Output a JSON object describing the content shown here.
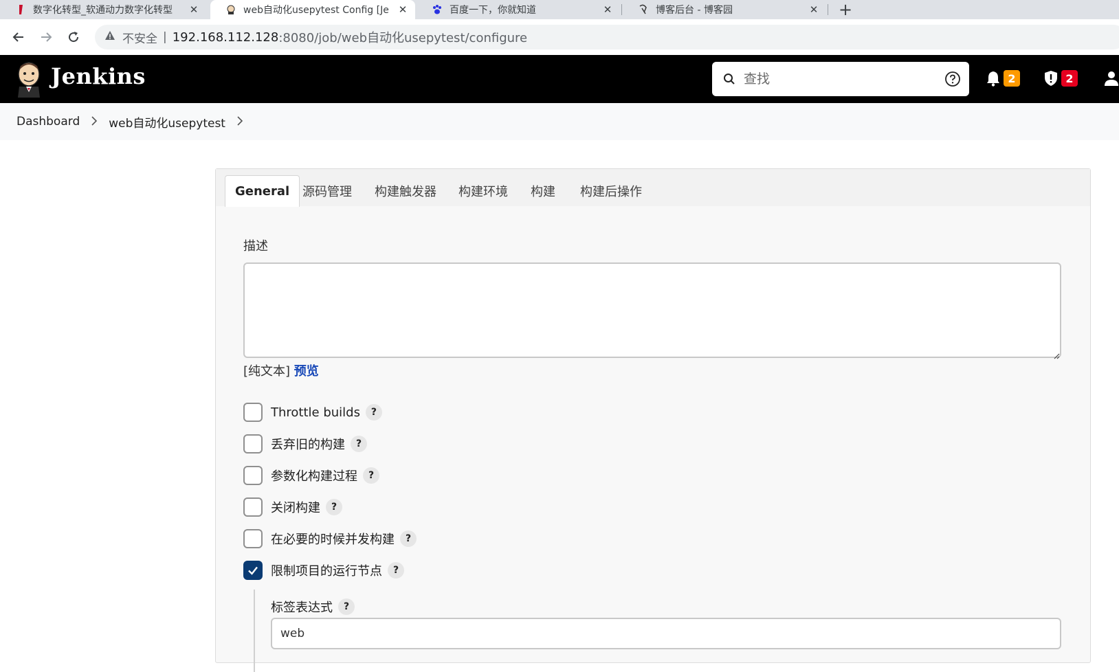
{
  "browser": {
    "tabs": [
      {
        "title": "数字化转型_软通动力数字化转型",
        "favicon": "red-bookmark-icon"
      },
      {
        "title": "web自动化usepytest Config [Je",
        "favicon": "jenkins-butler-icon"
      },
      {
        "title": "百度一下，你就知道",
        "favicon": "baidu-paw-icon"
      },
      {
        "title": "博客后台 - 博客园",
        "favicon": "cnblogs-icon"
      }
    ],
    "address": {
      "insecure_label": "不安全",
      "separator": "|",
      "host": "192.168.112.128",
      "rest": ":8080/job/web自动化usepytest/configure"
    }
  },
  "header": {
    "brand": "Jenkins",
    "search_placeholder": "查找",
    "notifications_count": "2",
    "security_count": "2",
    "colors": {
      "notification_badge": "#fe9a00",
      "security_badge": "#e6001f"
    }
  },
  "breadcrumb": {
    "items": [
      "Dashboard",
      "web自动化usepytest"
    ]
  },
  "config": {
    "tabs": [
      "General",
      "源码管理",
      "构建触发器",
      "构建环境",
      "构建",
      "构建后操作"
    ],
    "active_tab": "General",
    "description_label": "描述",
    "description_value": "",
    "plain_text_label": "[纯文本]",
    "preview_label": "预览",
    "options": [
      {
        "label": "Throttle builds",
        "checked": false
      },
      {
        "label": "丢弃旧的构建",
        "checked": false
      },
      {
        "label": "参数化构建过程",
        "checked": false
      },
      {
        "label": "关闭构建",
        "checked": false
      },
      {
        "label": "在必要的时候并发构建",
        "checked": false
      },
      {
        "label": "限制项目的运行节点",
        "checked": true
      }
    ],
    "label_expression_label": "标签表达式",
    "label_expression_value": "web",
    "help_glyph": "?"
  }
}
